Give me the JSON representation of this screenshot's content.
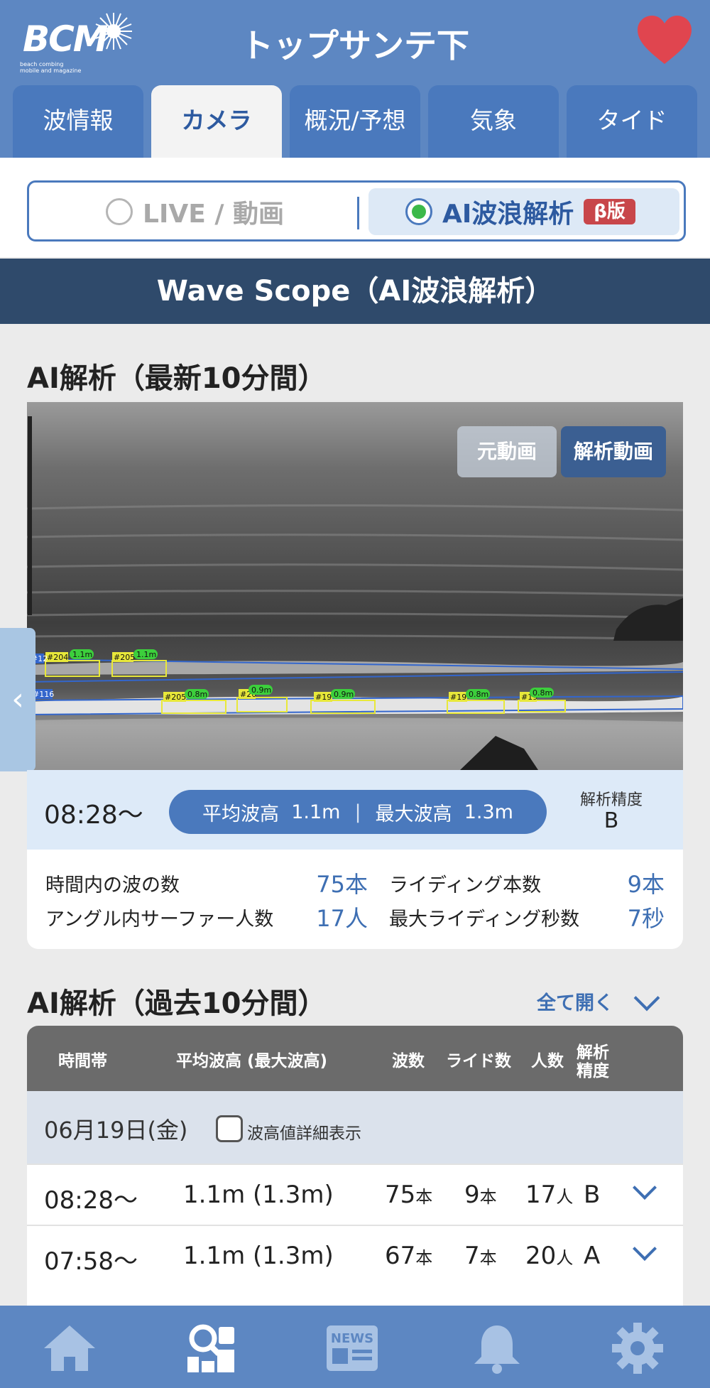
{
  "header": {
    "logo_text": "BCM",
    "logo_sub": "beach combing mobile and magazine",
    "title": "トップサンテ下"
  },
  "tabs": [
    {
      "label": "波情報",
      "active": false
    },
    {
      "label": "カメラ",
      "active": true
    },
    {
      "label": "概況/予想",
      "active": false
    },
    {
      "label": "気象",
      "active": false
    },
    {
      "label": "タイド",
      "active": false
    }
  ],
  "mode_toggle": {
    "live_label": "LIVE / 動画",
    "ai_label": "AI波浪解析",
    "beta_label": "β版",
    "selected": "ai"
  },
  "wavescope_title": "Wave Scope（AI波浪解析）",
  "latest": {
    "heading": "AI解析（最新10分間）",
    "video_buttons": {
      "original": "元動画",
      "analysis": "解析動画",
      "selected": "analysis"
    },
    "overlay_labels": {
      "boxes": [
        "#204",
        "#205",
        "#12",
        "#116",
        "#205",
        "#20",
        "#19",
        "#19",
        "#19"
      ],
      "heights": [
        "1.1m",
        "1.1m",
        "0.8m",
        "0.9m",
        "0.9m",
        "0.8m",
        "0.8m"
      ]
    },
    "time": "08:28〜",
    "avg_label": "平均波高",
    "avg_value": "1.1m",
    "max_label": "最大波高",
    "max_value": "1.3m",
    "accuracy_label": "解析精度",
    "accuracy_value": "B",
    "stats": [
      {
        "label": "時間内の波の数",
        "value": "75本"
      },
      {
        "label": "ライディング本数",
        "value": "9本"
      },
      {
        "label": "アングル内サーファー人数",
        "value": "17人"
      },
      {
        "label": "最大ライディング秒数",
        "value": "7秒"
      }
    ]
  },
  "history": {
    "heading": "AI解析（過去10分間）",
    "open_all": "全て開く",
    "columns": [
      "時間帯",
      "平均波高 (最大波高)",
      "波数",
      "ライド数",
      "人数",
      "解析",
      "精度"
    ],
    "date": "06月19日(金)",
    "detail_toggle_label": "波高値詳細表示",
    "rows": [
      {
        "time": "08:28〜",
        "height": "1.1m (1.3m)",
        "waves": "75",
        "rides": "9",
        "people": "17",
        "accuracy": "B"
      },
      {
        "time": "07:58〜",
        "height": "1.1m (1.3m)",
        "waves": "67",
        "rides": "7",
        "people": "20",
        "accuracy": "A"
      }
    ],
    "unit_waves": "本",
    "unit_people": "人"
  },
  "bottom_nav": [
    {
      "icon": "home-icon"
    },
    {
      "icon": "search-camera-icon"
    },
    {
      "icon": "news-icon",
      "label": "NEWS"
    },
    {
      "icon": "bell-icon"
    },
    {
      "icon": "gear-icon"
    }
  ],
  "colors": {
    "header_bg": "#5d87c2",
    "tab_active_text": "#2d5aa0",
    "accent_blue": "#4a79bd",
    "title_bar": "#2f4a6b",
    "heart": "#e0454f",
    "radio_on": "#3cb94a",
    "beta_badge": "#c8464a"
  }
}
